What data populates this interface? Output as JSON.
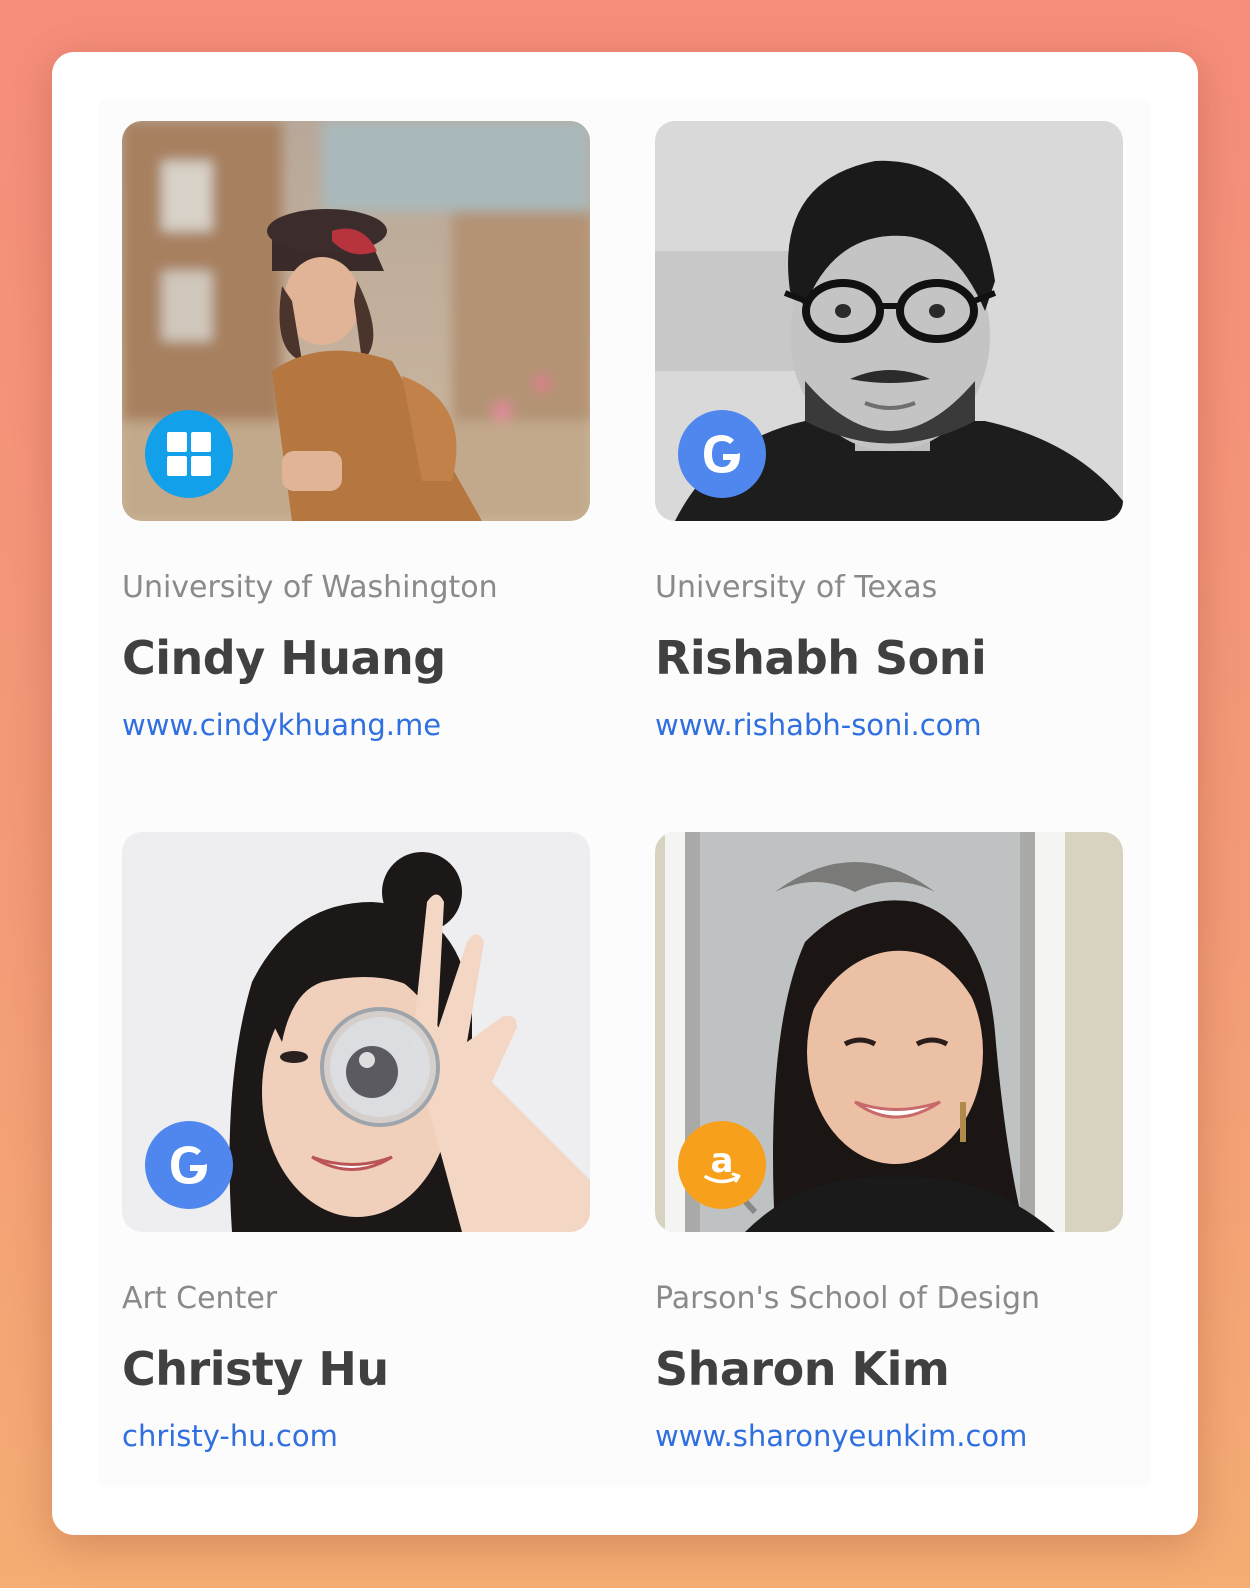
{
  "colors": {
    "background_top": "#f58d7a",
    "background_bottom": "#f5ad73",
    "name_text": "#404040",
    "school_text": "#8a8a8a",
    "link_text": "#2f6fe0",
    "microsoft_badge": "#12a0ea",
    "google_badge": "#4f87ee",
    "amazon_badge": "#f7a01b"
  },
  "profiles": [
    {
      "school": "University of Washington",
      "name": "Cindy Huang",
      "link": "www.cindykhuang.me",
      "company_icon": "microsoft-windows-icon"
    },
    {
      "school": "University of Texas",
      "name": "Rishabh Soni",
      "link": "www.rishabh-soni.com",
      "company_icon": "google-g-icon"
    },
    {
      "school": "Art Center",
      "name": "Christy Hu",
      "link": "christy-hu.com",
      "company_icon": "google-g-icon"
    },
    {
      "school": "Parson's School of Design",
      "name": "Sharon Kim",
      "link": "www.sharonyeunkim.com",
      "company_icon": "amazon-a-icon"
    }
  ]
}
